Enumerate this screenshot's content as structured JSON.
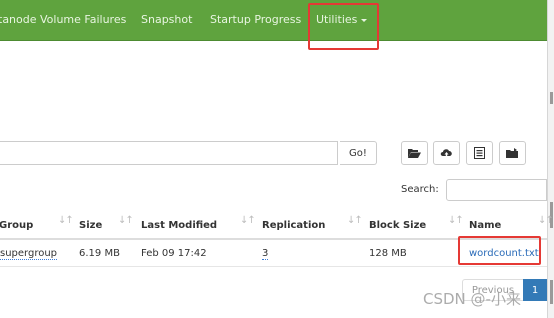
{
  "nav": {
    "items": [
      {
        "label": "tanode Volume Failures"
      },
      {
        "label": "Snapshot"
      },
      {
        "label": "Startup Progress"
      }
    ],
    "utilities_label": "Utilities"
  },
  "path_bar": {
    "value": "",
    "go_label": "Go!",
    "buttons": [
      {
        "icon": "folder-open-icon"
      },
      {
        "icon": "upload-icon"
      },
      {
        "icon": "list-icon"
      },
      {
        "icon": "folder-move-icon"
      }
    ]
  },
  "search": {
    "label": "Search:",
    "value": ""
  },
  "table": {
    "headers": [
      "Group",
      "Size",
      "Last Modified",
      "Replication",
      "Block Size",
      "Name"
    ],
    "rows": [
      {
        "group": "supergroup",
        "size": "6.19 MB",
        "last_modified": "Feb 09 17:42",
        "replication": "3",
        "block_size": "128 MB",
        "name": "wordcount.txt"
      }
    ]
  },
  "pagination": {
    "previous_label": "Previous",
    "current_page": "1"
  },
  "watermark": {
    "text": "CSDN @-小来"
  },
  "colors": {
    "navbar": "#5fa33e",
    "highlight": "#e53935",
    "link": "#2a6bb8",
    "active_page": "#337ab7"
  }
}
